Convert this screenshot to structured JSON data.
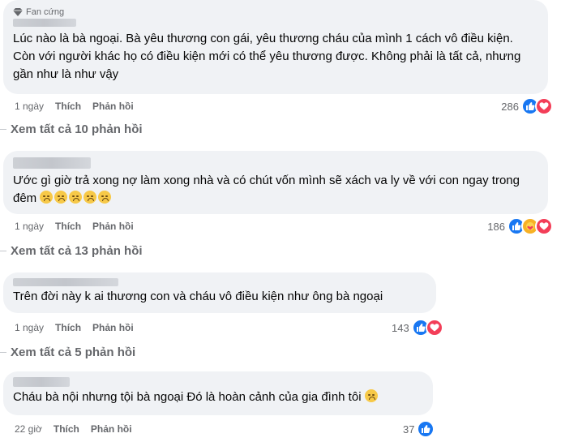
{
  "comments": [
    {
      "badge": "Fan cứng",
      "text": "Lúc nào là bà ngoại. Bà yêu thương con gái, yêu thương cháu của mình 1 cách vô điều kiện. Còn với người khác họ có điều kiện mới có thể yêu thương được. Không phải là tất cả, nhưng gần như là như vậy",
      "time": "1 ngày",
      "like_label": "Thích",
      "reply_label": "Phản hồi",
      "reaction_count": "286",
      "reactions": [
        "like-icon",
        "love-icon"
      ],
      "view_replies": "Xem tất cả 10 phản hồi"
    },
    {
      "text": "Ước gì giờ trả xong nợ làm xong nhà và có chút vốn mình sẽ xách va ly về với con ngay trong đêm",
      "emoji_count": 5,
      "emoji": "sad-face-emoji",
      "time": "1 ngày",
      "like_label": "Thích",
      "reply_label": "Phản hồi",
      "reaction_count": "186",
      "reactions": [
        "like-icon",
        "care-icon",
        "love-icon"
      ],
      "view_replies": "Xem tất cả 13 phản hồi"
    },
    {
      "text": "Trên đời này k ai thương con và cháu vô điều kiện như ông bà ngoại",
      "time": "1 ngày",
      "like_label": "Thích",
      "reply_label": "Phản hồi",
      "reaction_count": "143",
      "reactions": [
        "like-icon",
        "love-icon"
      ],
      "view_replies": "Xem tất cả 5 phản hồi"
    },
    {
      "text": "Cháu bà nội nhưng tội bà ngoại Đó là hoàn cảnh của gia đình tôi",
      "emoji_count": 1,
      "emoji": "sad-face-emoji",
      "time": "22 giờ",
      "like_label": "Thích",
      "reply_label": "Phản hồi",
      "reaction_count": "37",
      "reactions": [
        "like-icon"
      ]
    }
  ],
  "colors": {
    "bubble": "#f0f2f5",
    "meta_text": "#65676b",
    "like": "#1877f2",
    "love": "#f33e58",
    "care": "#f7b125"
  }
}
